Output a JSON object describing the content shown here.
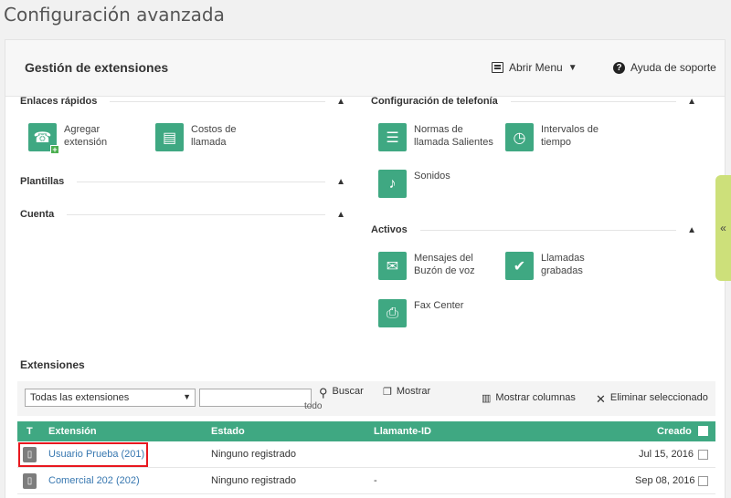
{
  "page_title": "Configuración avanzada",
  "panel": {
    "title": "Gestión de extensiones",
    "menu_label": "Abrir Menu",
    "help_label": "Ayuda de soporte"
  },
  "sections": {
    "quick_links": {
      "title": "Enlaces rápidos",
      "items": [
        {
          "line1": "Agregar",
          "line2": "extensión"
        },
        {
          "line1": "Costos de",
          "line2": "llamada"
        }
      ]
    },
    "templates": {
      "title": "Plantillas"
    },
    "account": {
      "title": "Cuenta"
    },
    "phone_config": {
      "title": "Configuración de telefonía",
      "items": [
        {
          "line1": "Normas de",
          "line2": "llamada Salientes"
        },
        {
          "line1": "Intervalos de",
          "line2": "tiempo"
        },
        {
          "line1": "Sonidos",
          "line2": ""
        }
      ]
    },
    "assets": {
      "title": "Activos",
      "items": [
        {
          "line1": "Mensajes del",
          "line2": "Buzón de voz"
        },
        {
          "line1": "Llamadas",
          "line2": "grabadas"
        },
        {
          "line1": "Fax Center",
          "line2": ""
        }
      ]
    }
  },
  "extensions": {
    "title": "Extensiones",
    "filter_value": "Todas las extensiones",
    "search_value": "",
    "search_label": "Buscar",
    "search_sub": "todo",
    "show_label": "Mostrar",
    "columns_label": "Mostrar columnas",
    "delete_label": "Eliminar seleccionado",
    "columns": [
      "T",
      "Extensión",
      "Estado",
      "Llamante-ID",
      "Creado"
    ],
    "rows": [
      {
        "extension": "Usuario Prueba (201)",
        "status": "Ninguno registrado",
        "caller_id": "",
        "created": "Jul 15, 2016"
      },
      {
        "extension": "Comercial 202 (202)",
        "status": "Ninguno registrado",
        "caller_id": "-",
        "created": "Sep 08, 2016"
      }
    ]
  },
  "colors": {
    "accent": "#3fa882",
    "link": "#3777b0",
    "highlight": "#e8181f",
    "side_tab": "#cde07a"
  }
}
